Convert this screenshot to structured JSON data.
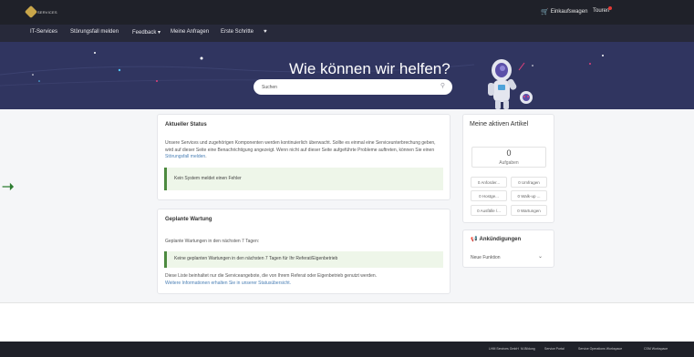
{
  "header": {
    "logo_text": "SERVICES",
    "cart_label": "Einkaufswagen",
    "tours_label": "Touren"
  },
  "nav": {
    "items": [
      "IT-Services",
      "Störungsfall melden",
      "Feedback ▾",
      "Meine Anfragen",
      "Erste Schritte",
      "♥"
    ]
  },
  "hero": {
    "title": "Wie können wir helfen?",
    "search_placeholder": "Suchen"
  },
  "status": {
    "title": "Aktueller Status",
    "text_before_link": "Unsere Services und zugehörigen Komponenten werden kontinuierlich überwacht. Sollte es einmal eine Serviceunterbrechung geben, wird auf dieser Seite eine Benachrichtigung angezeigt. Wenn nicht auf dieser Seite aufgeführte Probleme auftreten, können Sie einen ",
    "link": "Störungsfall melden",
    "text_after_link": ".",
    "alert": "Kein System meldet einen Fehler"
  },
  "maintenance": {
    "title": "Geplante Wartung",
    "subtitle": "Geplante Wartungen in den nächsten 7 Tagen:",
    "alert": "Keine geplanten Wartungen in den nächsten 7 Tagen für Ihr Referat/Eigenbetrieb",
    "note1": "Diese Liste beinhaltet nur die Serviceangebote, die von Ihrem Referat oder Eigenbetrieb genutzt werden.",
    "note2": "Weitere Informationen erhalten Sie in unserer Statusübersicht."
  },
  "my_items": {
    "title": "Meine aktiven Artikel",
    "count": "0",
    "count_label": "Aufgaben",
    "pills": [
      "0 Anforder...",
      "0 Umfragen",
      "0 Hostge...",
      "0 Walk-up ...",
      "0 Ausfälle /...",
      "0 Wartungen"
    ]
  },
  "announcements": {
    "title": "Ankündigungen",
    "item": "Neue Funktion"
  },
  "footer": {
    "links": [
      "LHM Services GmbH",
      "M-Bildung",
      "Service Portal",
      "Service Operations Workspace",
      "CSM Workspace"
    ]
  },
  "colors": {
    "topbar": "#1f2129",
    "navbar": "#27293a",
    "hero": "#303560",
    "alert_bg": "#eef6e9",
    "alert_accent": "#4c8a3f",
    "arrow": "#2e7d32"
  },
  "icons": [
    "logo-icon",
    "cart-icon",
    "notification-dot-icon",
    "heart-icon",
    "search-icon",
    "megaphone-icon",
    "chevron-down-icon",
    "arrow-right-icon"
  ]
}
